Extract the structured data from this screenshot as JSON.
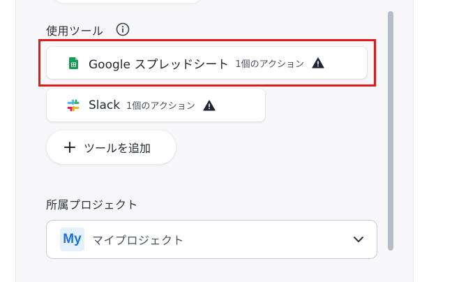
{
  "tools_section": {
    "title": "使用ツール",
    "tools": [
      {
        "name": "Google スプレッドシート",
        "count": "1個のアクション",
        "icon": "google-sheets-icon",
        "color": "#0f9d58"
      },
      {
        "name": "Slack",
        "count": "1個のアクション",
        "icon": "slack-icon"
      }
    ],
    "add_label": "ツールを追加",
    "highlight_color": "#e01b1b"
  },
  "project_section": {
    "title": "所属プロジェクト",
    "badge": "My",
    "badge_color": "#1a73d9",
    "selected": "マイプロジェクト"
  }
}
